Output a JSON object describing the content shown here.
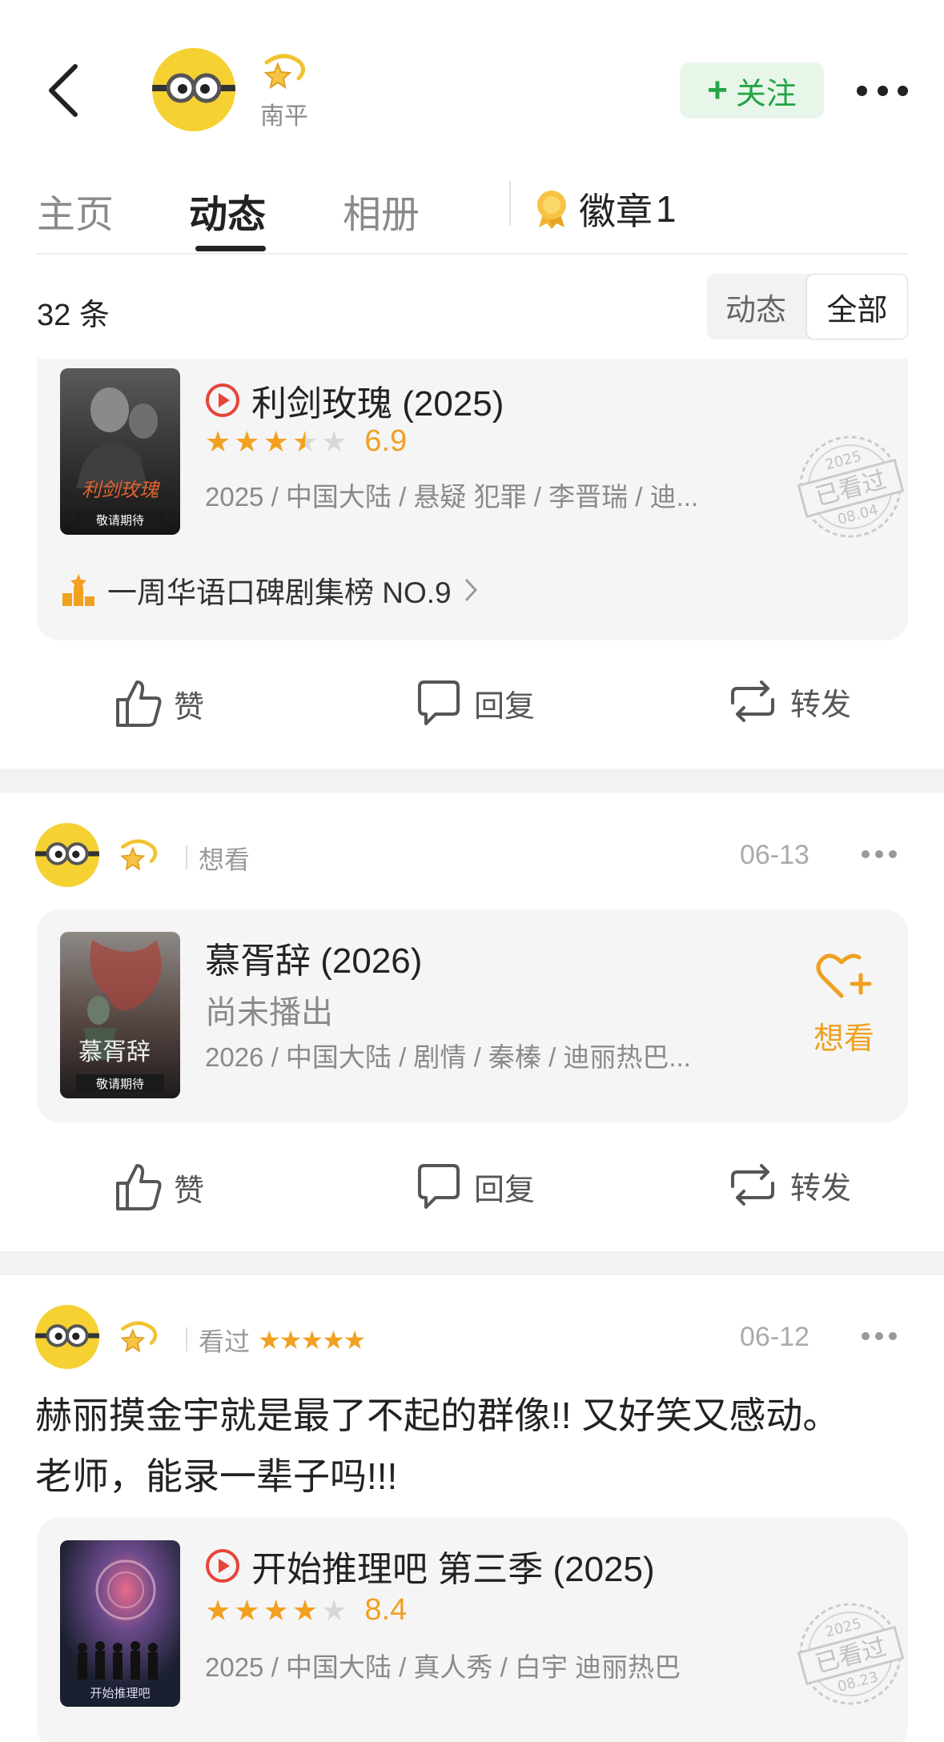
{
  "header": {
    "user_name": "南平",
    "follow_label": "关注",
    "colors": {
      "follow_bg": "#e8f6ea",
      "follow_text": "#23a546",
      "avatar": "#f5d132",
      "star": "#f2a020"
    }
  },
  "tabs": {
    "items": [
      {
        "label": "主页"
      },
      {
        "label": "动态"
      },
      {
        "label": "相册"
      }
    ],
    "badge_label": "徽章",
    "badge_count": "1"
  },
  "filter": {
    "count_text": "32 条",
    "options": [
      "动态",
      "全部"
    ],
    "selected": "全部"
  },
  "post1": {
    "title": "利剑玫瑰 (2025)",
    "rating_stars": 3.5,
    "score": "6.9",
    "meta": "2025 / 中国大陆 / 悬疑 犯罪 / 李晋瑞 / 迪...",
    "rank_text": "一周华语口碑剧集榜 NO.9",
    "stamp": {
      "year": "2025",
      "label": "已看过",
      "date": "08.04"
    },
    "poster": {
      "title": "利剑玫瑰",
      "tagline": "敬请期待"
    }
  },
  "actions": {
    "like": "赞",
    "reply": "回复",
    "share": "转发"
  },
  "post2": {
    "action": "想看",
    "date": "06-13",
    "title": "慕胥辞 (2026)",
    "status": "尚未播出",
    "meta": "2026 / 中国大陆 / 剧情 / 秦榛 / 迪丽热巴...",
    "want_label": "想看",
    "poster": {
      "title": "慕胥辞",
      "tagline": "敬请期待"
    }
  },
  "post3": {
    "action": "看过",
    "rating_stars": 5,
    "date": "06-12",
    "review_line1": "赫丽摸金宇就是最了不起的群像!! 又好笑又感动。",
    "review_line2": "老师，能录一辈子吗!!!",
    "title": "开始推理吧 第三季 (2025)",
    "movie_stars": 4,
    "score": "8.4",
    "meta": "2025 / 中国大陆 / 真人秀 / 白宇 迪丽热巴",
    "stamp": {
      "year": "2025",
      "label": "已看过",
      "date": "08.23"
    },
    "poster": {
      "title": "开始推理吧"
    }
  }
}
